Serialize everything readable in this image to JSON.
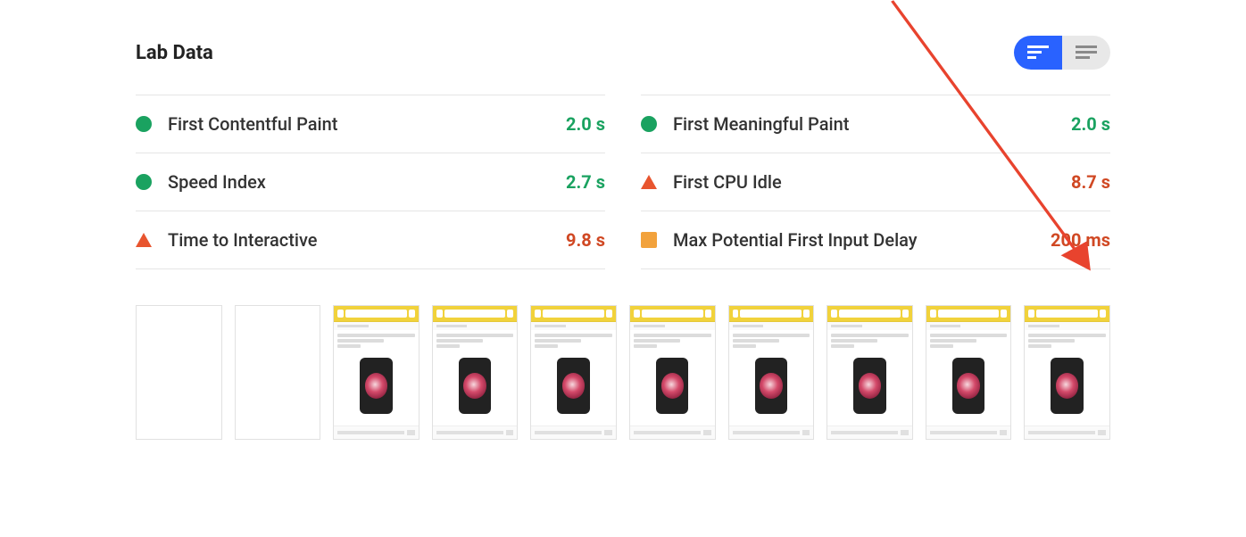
{
  "header": {
    "title": "Lab Data"
  },
  "metrics": {
    "left": [
      {
        "label": "First Contentful Paint",
        "value": "2.0 s",
        "status": "pass"
      },
      {
        "label": "Speed Index",
        "value": "2.7 s",
        "status": "pass"
      },
      {
        "label": "Time to Interactive",
        "value": "9.8 s",
        "status": "warn"
      }
    ],
    "right": [
      {
        "label": "First Meaningful Paint",
        "value": "2.0 s",
        "status": "pass"
      },
      {
        "label": "First CPU Idle",
        "value": "8.7 s",
        "status": "warn"
      },
      {
        "label": "Max Potential First Input Delay",
        "value": "200 ms",
        "status": "avg"
      }
    ]
  },
  "filmstrip": {
    "frames": [
      {
        "blank": true
      },
      {
        "blank": true
      },
      {
        "blank": false
      },
      {
        "blank": false
      },
      {
        "blank": false
      },
      {
        "blank": false
      },
      {
        "blank": false
      },
      {
        "blank": false
      },
      {
        "blank": false
      },
      {
        "blank": false
      }
    ]
  },
  "colors": {
    "pass": "#1aa260",
    "warn": "#e8552f",
    "avg": "#f2a23c",
    "accent": "#2962ff"
  }
}
